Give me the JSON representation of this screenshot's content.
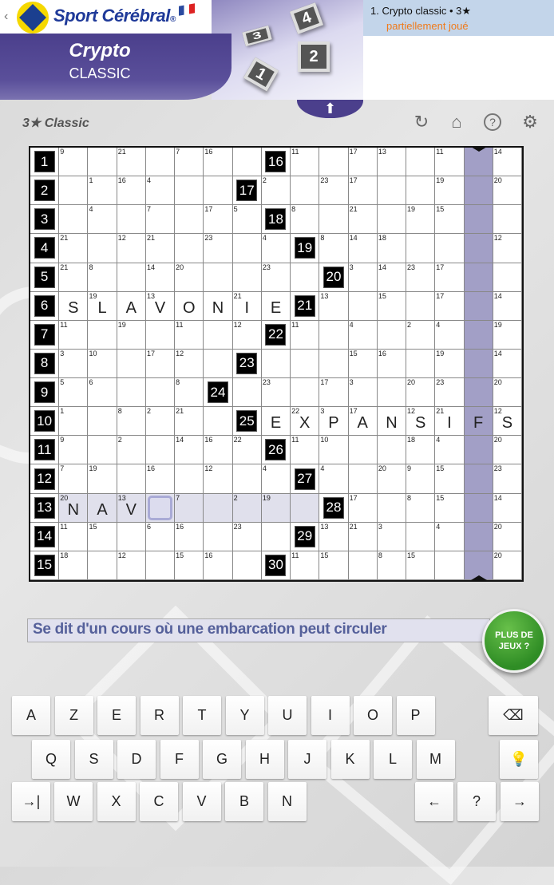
{
  "header": {
    "back": "‹",
    "brand": "Sport Cérébral",
    "brand_mark": "®",
    "title": "Crypto",
    "subtitle": "CLASSIC",
    "tiles": [
      "4",
      "3",
      "2",
      "1"
    ]
  },
  "panel": {
    "item_title": "1.  Crypto classic • 3★",
    "item_status": "partiellement joué"
  },
  "level": "3★ Classic",
  "toolbar": {
    "icons": [
      "refresh-icon",
      "home-icon",
      "help-icon",
      "settings-icon"
    ],
    "glyphs": [
      "↻",
      "⌂",
      "?",
      "⚙"
    ]
  },
  "grid": {
    "row_labels": [
      "1",
      "2",
      "3",
      "4",
      "5",
      "6",
      "7",
      "8",
      "9",
      "10",
      "11",
      "12",
      "13",
      "14",
      "15"
    ],
    "highlight_row": 13,
    "highlight_cols": [
      1,
      9
    ],
    "selected": {
      "row": 13,
      "col": 4
    },
    "purple_col": 15,
    "rows": [
      [
        "9",
        "",
        "21",
        "",
        "7",
        "16",
        "",
        "#16",
        "11",
        "",
        "17",
        "13",
        "",
        "11",
        "",
        "14"
      ],
      [
        "",
        "1",
        "16",
        "4",
        "",
        "",
        "#17",
        "2",
        "",
        "23",
        "17",
        "",
        "",
        "19",
        "",
        "20"
      ],
      [
        "",
        "4",
        "",
        "7",
        "",
        "17",
        "5",
        "#18",
        "8",
        "",
        "21",
        "",
        "19",
        "15",
        "",
        ""
      ],
      [
        "21",
        "",
        "12",
        "21",
        "",
        "23",
        "",
        "4",
        "#19",
        "8",
        "14",
        "18",
        "",
        "",
        "",
        "12"
      ],
      [
        "21",
        "8",
        "",
        "14",
        "20",
        "",
        "",
        "23",
        "",
        "#20",
        "3",
        "14",
        "23",
        "17",
        "",
        ""
      ],
      [
        ":S",
        "19:L",
        ":A",
        "13:V",
        ":O",
        ":N",
        "21:I",
        ":E",
        "#21",
        "13",
        "",
        "15",
        "",
        "17",
        "",
        "14"
      ],
      [
        "11",
        "",
        "19",
        "",
        "11",
        "",
        "12",
        "#22",
        "11",
        "",
        "4",
        "",
        "2",
        "4",
        "",
        "19"
      ],
      [
        "3",
        "10",
        "",
        "17",
        "12",
        "",
        "#23",
        "",
        "",
        "",
        "15",
        "16",
        "",
        "19",
        "",
        "14"
      ],
      [
        "5",
        "6",
        "",
        "",
        "8",
        "#24",
        "",
        "23",
        "",
        "17",
        "3",
        "",
        "20",
        "23",
        "",
        "20"
      ],
      [
        "1",
        "",
        "8",
        "2",
        "21",
        "",
        "#25",
        ":E",
        "22:X",
        "3:P",
        "17:A",
        ":N",
        "12:S",
        "21:I",
        ":F",
        "12:S"
      ],
      [
        "9",
        "",
        "2",
        "",
        "14",
        "16",
        "22",
        "#26",
        "11",
        "10",
        "",
        "",
        "18",
        "4",
        "",
        "20"
      ],
      [
        "7",
        "19",
        "",
        "16",
        "",
        "12",
        "",
        "4",
        "#27",
        "4",
        "",
        "20",
        "9",
        "15",
        "",
        "23"
      ],
      [
        "20:N",
        ":A",
        "13:V",
        "",
        "7",
        "",
        "2",
        "19",
        "",
        "#28",
        "17",
        "",
        "8",
        "15",
        "",
        "14"
      ],
      [
        "11",
        "15",
        "",
        "6",
        "16",
        "",
        "23",
        "",
        "#29",
        "13",
        "21",
        "3",
        "",
        "4",
        "",
        "20"
      ],
      [
        "18",
        "",
        "12",
        "",
        "15",
        "16",
        "",
        "#30",
        "11",
        "15",
        "",
        "8",
        "15",
        "",
        "",
        "20"
      ]
    ]
  },
  "clue": "Se dit d'un cours où une embarcation peut circuler",
  "more_games": "PLUS DE JEUX ?",
  "keyboard": {
    "row1": [
      "A",
      "Z",
      "E",
      "R",
      "T",
      "Y",
      "U",
      "I",
      "O",
      "P"
    ],
    "row2": [
      "Q",
      "S",
      "D",
      "F",
      "G",
      "H",
      "J",
      "K",
      "L",
      "M"
    ],
    "row3": [
      "W",
      "X",
      "C",
      "V",
      "B",
      "N"
    ],
    "backspace": "⌫",
    "hint": "💡",
    "tab": "→|",
    "left": "←",
    "clue_help": "?",
    "right": "→"
  },
  "colors": {
    "purple": "#4b3f8c",
    "highlight": "#e0e0ec",
    "column": "#a29fc6",
    "status": "#f07a1a",
    "clue_text": "#55609a",
    "green": "#2f8d25"
  }
}
